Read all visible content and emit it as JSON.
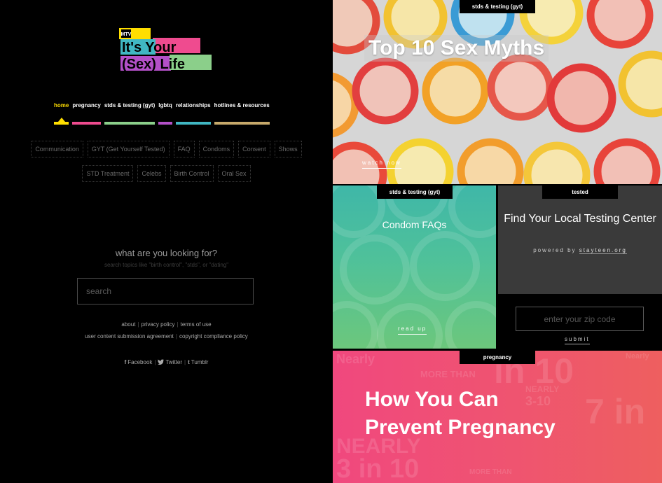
{
  "logo": {
    "brand": "MTV",
    "line1": "It's Your",
    "line2": "(Sex) Life"
  },
  "nav": [
    {
      "label": "home",
      "color": "#ffde00",
      "active": true
    },
    {
      "label": "pregnancy",
      "color": "#ef4b8f"
    },
    {
      "label": "stds & testing (gyt)",
      "color": "#8bcf8a"
    },
    {
      "label": "lgbtq",
      "color": "#b350c8"
    },
    {
      "label": "relationships",
      "color": "#40b7c3"
    },
    {
      "label": "hotlines & resources",
      "color": "#c7a96b"
    }
  ],
  "tags": [
    "Communication",
    "GYT (Get Yourself Tested)",
    "FAQ",
    "Condoms",
    "Consent",
    "Shows",
    "STD Treatment",
    "Celebs",
    "Birth Control",
    "Oral Sex"
  ],
  "search": {
    "title": "what are you looking for?",
    "hint": "search topics like \"birth control\", \"stds\", or \"dating\"",
    "placeholder": "search"
  },
  "footer": {
    "links1": [
      "about",
      "privacy policy",
      "terms of use"
    ],
    "links2": [
      "user content submission agreement",
      "copyright compliance policy"
    ],
    "social": [
      {
        "icon": "f",
        "label": "Facebook"
      },
      {
        "icon": "twitter-bird",
        "label": "Twitter"
      },
      {
        "icon": "t",
        "label": "Tumblr"
      }
    ]
  },
  "tiles": {
    "myths": {
      "category": "stds & testing (gyt)",
      "title": "Top 10 Sex Myths",
      "cta": "watch now"
    },
    "condoms": {
      "category": "stds & testing (gyt)",
      "title": "Condom FAQs",
      "cta": "read up"
    },
    "testing": {
      "category": "tested",
      "title": "Find Your Local Testing Center",
      "powered": "powered by",
      "powered_link": "stayteen.org",
      "zip_placeholder": "enter your zip code",
      "submit": "submit"
    },
    "pregnancy": {
      "category": "pregnancy",
      "title_line1": "How You Can",
      "title_line2": "Prevent Pregnancy",
      "bg_words": [
        "Nearly",
        "in 10",
        "MORE THAN",
        "NEARLY",
        "3-10",
        "7 in",
        "NEARLY",
        "3 in 10",
        "MORE THAN",
        "Nearly"
      ]
    }
  }
}
